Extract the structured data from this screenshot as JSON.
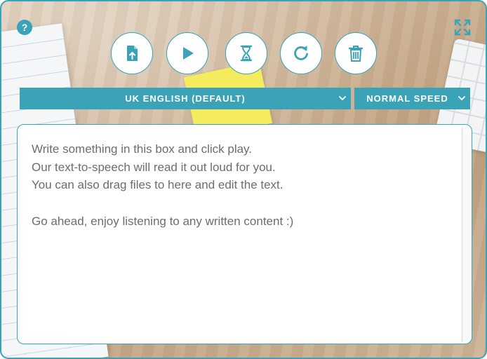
{
  "toolbar": {
    "icons": [
      "upload-file-icon",
      "play-icon",
      "hourglass-icon",
      "refresh-icon",
      "trash-icon"
    ]
  },
  "language_select": {
    "value": "UK ENGLISH (DEFAULT)"
  },
  "speed_select": {
    "value": "NORMAL SPEED"
  },
  "editor": {
    "lines": [
      "Write something in this box and click play.",
      "Our text-to-speech will read it out loud for you.",
      "You can also drag files to here and edit the text."
    ],
    "closing_line": "Go ahead, enjoy listening to any written content :)"
  },
  "help": {
    "symbol": "?"
  },
  "colors": {
    "accent": "#3aa3b8",
    "text": "#6a6d73",
    "background": "#ffffff"
  }
}
